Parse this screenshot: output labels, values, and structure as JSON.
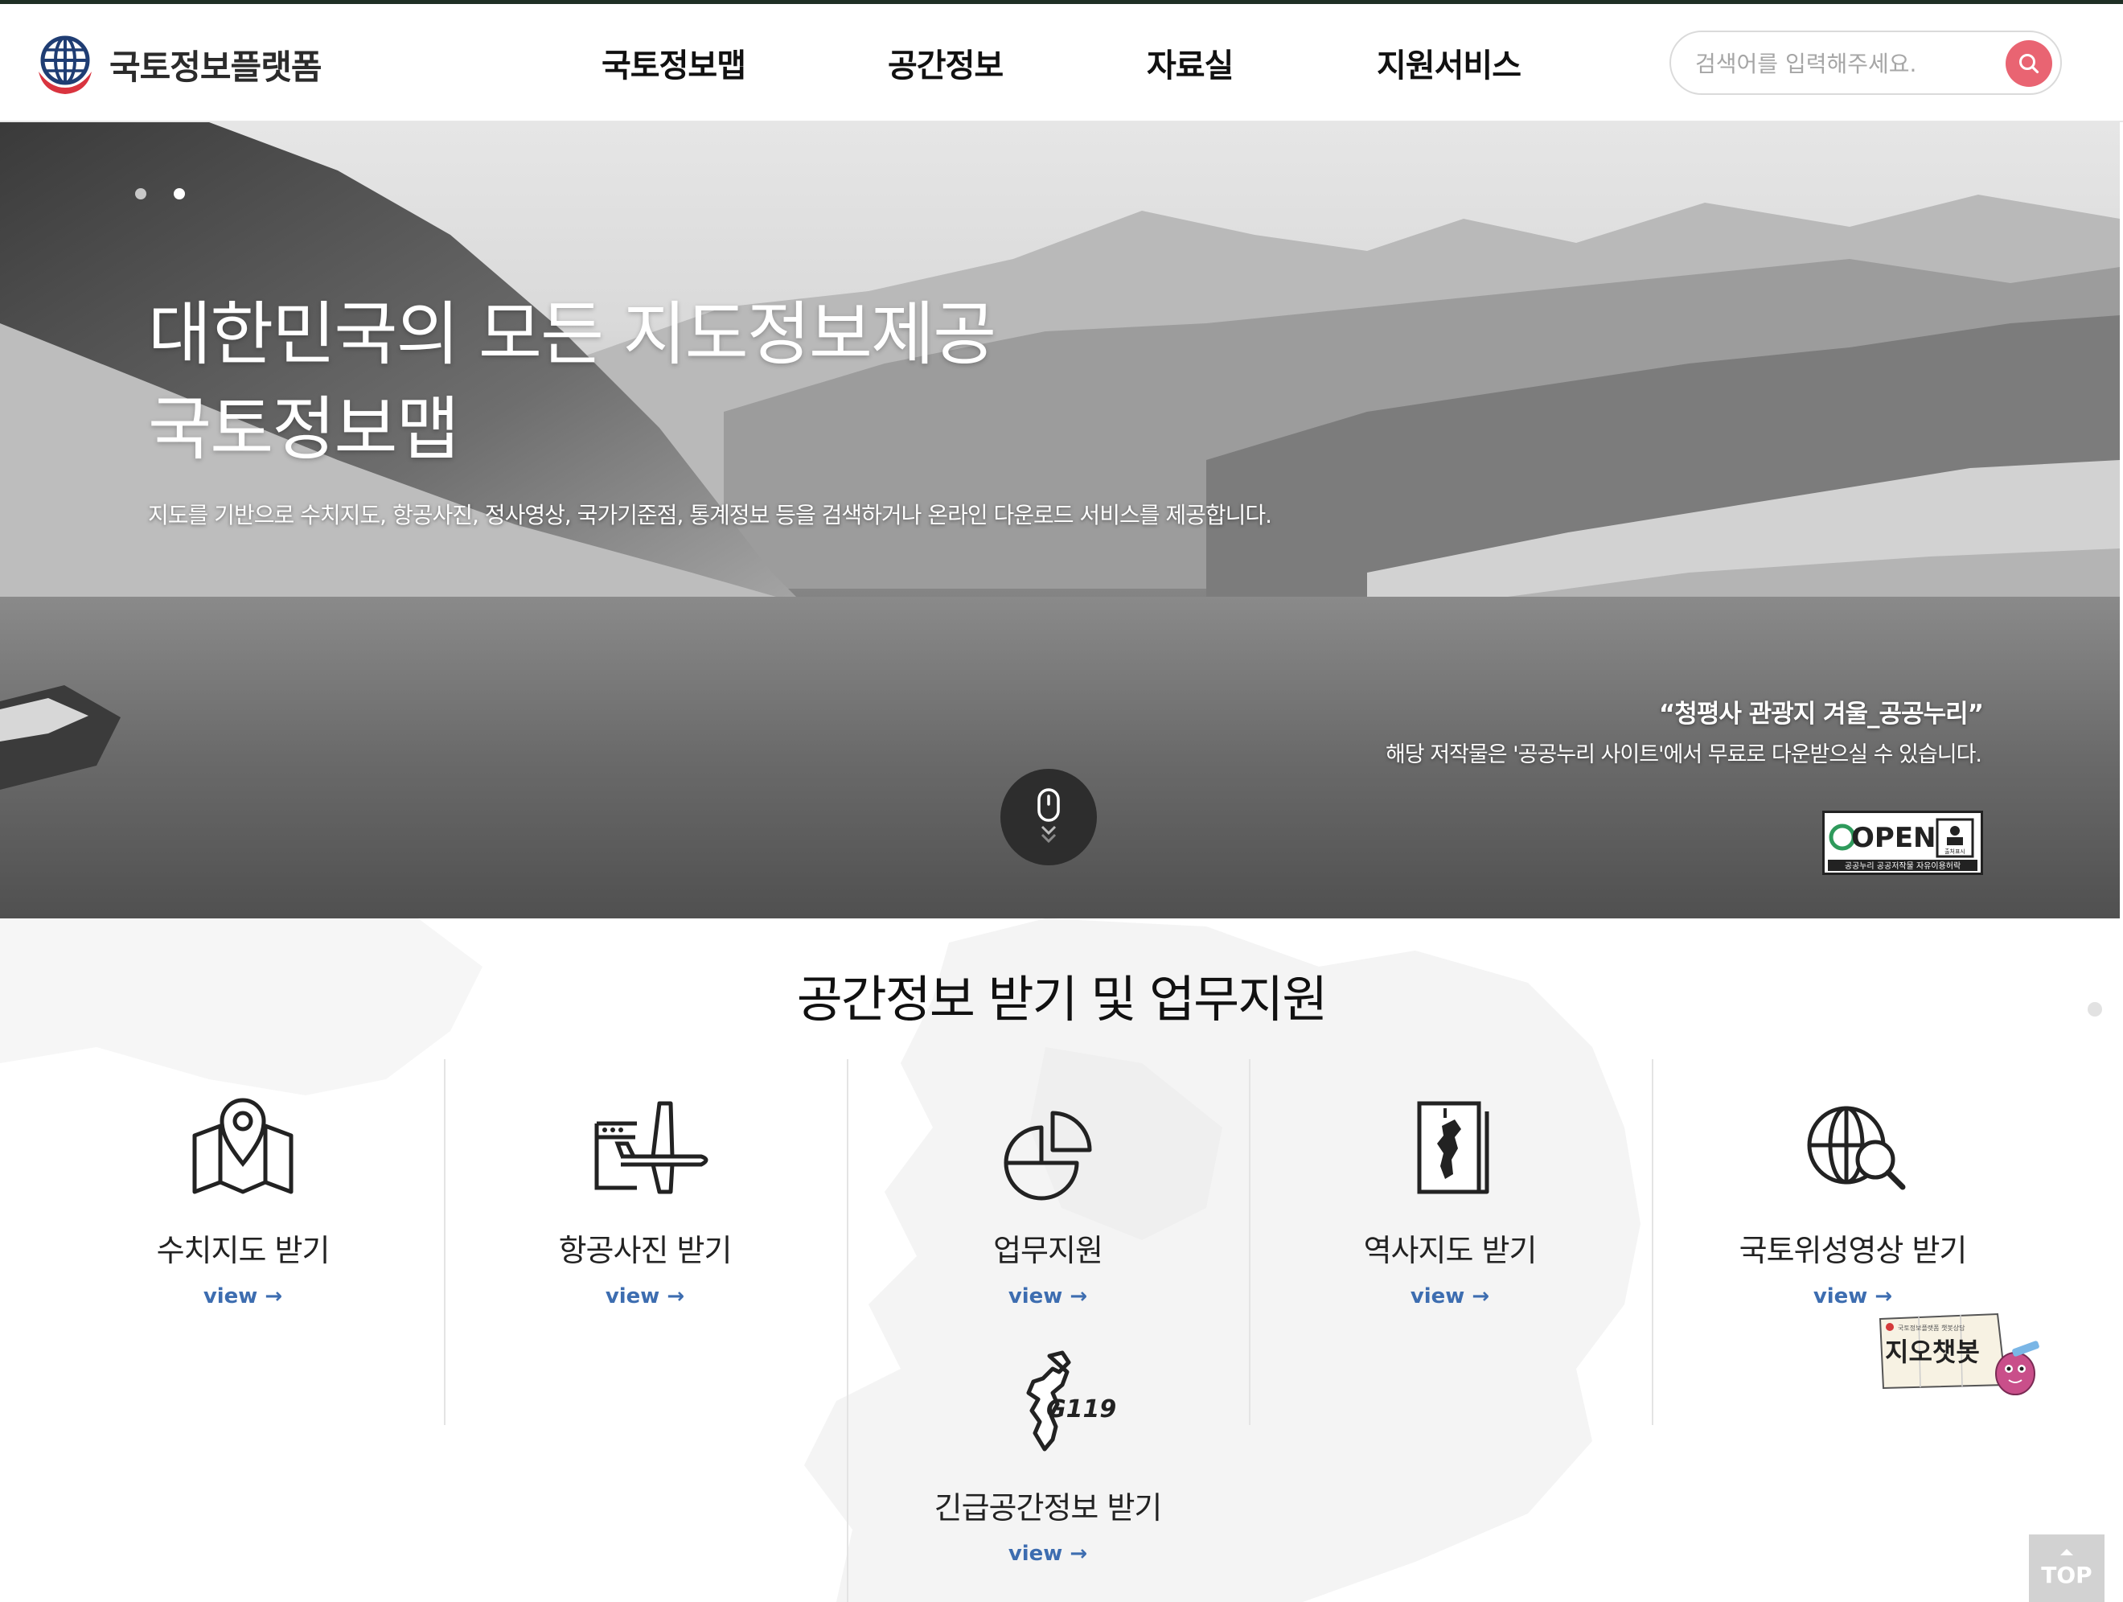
{
  "header": {
    "logo_text": "국토정보플랫폼",
    "nav": [
      {
        "label": "국토정보맵"
      },
      {
        "label": "공간정보"
      },
      {
        "label": "자료실"
      },
      {
        "label": "지원서비스"
      }
    ],
    "search": {
      "placeholder": "검색어를 입력해주세요.",
      "value": ""
    }
  },
  "hero": {
    "slide_count": 2,
    "active_slide": 2,
    "title_line1": "대한민국의 모든 지도정보제공",
    "title_line2": "국토정보맵",
    "description": "지도를 기반으로 수치지도, 항공사진, 정사영상, 국가기준점, 통계정보 등을 검색하거나 온라인 다운로드 서비스를 제공합니다.",
    "photo_credit": "“청평사 관광지 겨울_공공누리”",
    "photo_credit_note": "해당 저작물은 '공공누리 사이트'에서 무료로 다운받으실 수 있습니다.",
    "license_badge": {
      "title": "OPEN",
      "sub": "공공누리 공공저작물 자유이용허락",
      "type_label": "출처표시"
    }
  },
  "services": {
    "title": "공간정보 받기 및 업무지원",
    "items": [
      {
        "label": "수치지도 받기",
        "link": "view",
        "icon": "folded-map-pin-icon"
      },
      {
        "label": "항공사진 받기",
        "link": "view",
        "icon": "airplane-icon"
      },
      {
        "label": "업무지원",
        "link": "view",
        "icon": "pie-chart-icon"
      },
      {
        "label": "역사지도 받기",
        "link": "view",
        "icon": "korea-map-document-icon"
      },
      {
        "label": "국토위성영상 받기",
        "link": "view",
        "icon": "globe-search-icon"
      },
      {
        "label": "긴급공간정보 받기",
        "link": "view",
        "icon": "g119-korea-icon",
        "icon_text": "G119"
      }
    ]
  },
  "chatbot": {
    "label": "지오챗봇",
    "tagline": "국토정보플랫폼 챗봇상담"
  },
  "top_button": {
    "label": "TOP"
  },
  "colors": {
    "accent": "#e96472",
    "link": "#3d6db0",
    "header_line": "#1f2f25"
  }
}
